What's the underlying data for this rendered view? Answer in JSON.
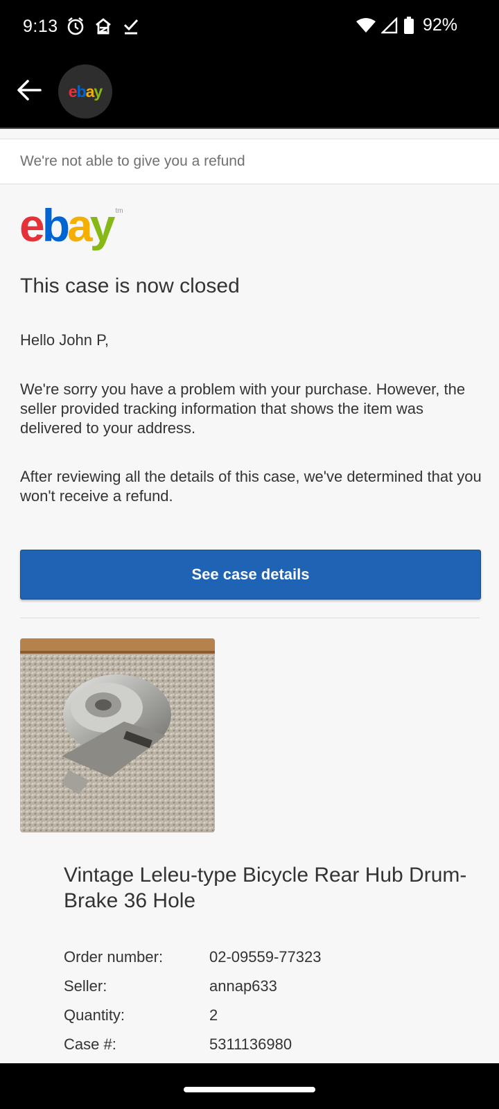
{
  "status_bar": {
    "time": "9:13",
    "battery": "92%",
    "icons_left": [
      "alarm-icon",
      "zillow-icon",
      "check-icon"
    ],
    "icons_right": [
      "wifi-icon",
      "cell-signal-icon",
      "battery-icon"
    ]
  },
  "header": {
    "back_icon": "arrow-left-icon",
    "avatar_logo": "ebay"
  },
  "email": {
    "subject": "We're not able to give you a refund",
    "logo": {
      "e": "e",
      "b": "b",
      "a": "a",
      "y": "y",
      "tm": "tm"
    },
    "heading": "This case is now closed",
    "greeting": "Hello John P,",
    "paragraph1": "We're sorry you have a problem with your purchase. However, the seller provided tracking information that shows the item was delivered to your address.",
    "paragraph2": "After reviewing all the details of this case, we've determined that you won't receive a refund.",
    "cta_label": "See case details",
    "item_title": "Vintage Leleu-type Bicycle Rear Hub Drum-Brake 36 Hole",
    "details": [
      {
        "label": "Order number:",
        "value": "02-09559-77323"
      },
      {
        "label": "Seller:",
        "value": "annap633"
      },
      {
        "label": "Quantity:",
        "value": "2"
      },
      {
        "label": "Case #:",
        "value": "5311136980"
      }
    ]
  },
  "colors": {
    "button_blue": "#1f63b5",
    "ebay_red": "#e53238",
    "ebay_blue": "#0064d2",
    "ebay_yellow": "#f5af02",
    "ebay_green": "#86b817"
  }
}
